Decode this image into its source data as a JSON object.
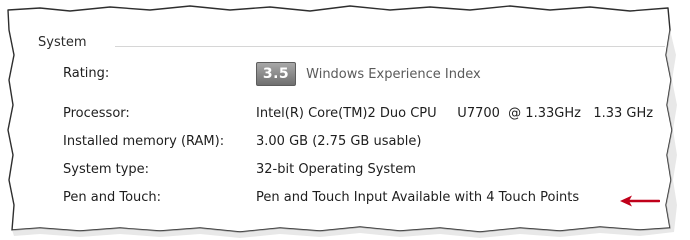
{
  "group": {
    "title": "System"
  },
  "rows": {
    "rating": {
      "label": "Rating:",
      "badge": "3.5",
      "link": "Windows Experience Index"
    },
    "processor": {
      "label": "Processor:",
      "value": "Intel(R) Core(TM)2 Duo CPU     U7700  @ 1.33GHz   1.33 GHz"
    },
    "memory": {
      "label": "Installed memory (RAM):",
      "value": "3.00 GB (2.75 GB usable)"
    },
    "system_type": {
      "label": "System type:",
      "value": "32-bit Operating System"
    },
    "pen_touch": {
      "label": "Pen and Touch:",
      "value": "Pen and Touch Input Available with 4 Touch Points"
    }
  },
  "colors": {
    "arrow": "#c0001a",
    "torn_edge": "#333333"
  }
}
